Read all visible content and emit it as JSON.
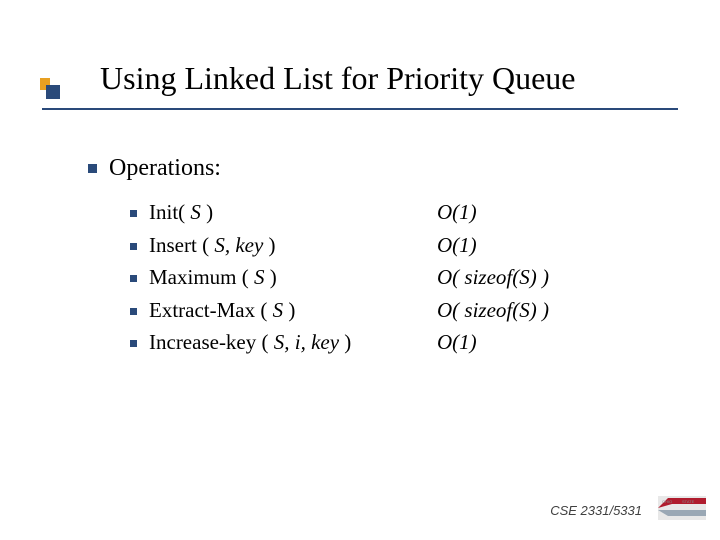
{
  "title": "Using Linked List for Priority Queue",
  "heading": "Operations:",
  "ops": [
    {
      "name_pre": "Init( ",
      "name_arg": "S",
      "name_post": " )",
      "comp": "O(1)"
    },
    {
      "name_pre": "Insert ( ",
      "name_arg": "S, key",
      "name_post": " )",
      "comp": "O(1)"
    },
    {
      "name_pre": "Maximum ( ",
      "name_arg": "S",
      "name_post": " )",
      "comp": "O( sizeof(S) )"
    },
    {
      "name_pre": "Extract-Max ( ",
      "name_arg": "S",
      "name_post": " )",
      "comp": "O( sizeof(S) )"
    },
    {
      "name_pre": "Increase-key ( ",
      "name_arg": "S, i, key",
      "name_post": " )",
      "comp": "O(1)"
    }
  ],
  "footer": "CSE 2331/5331"
}
